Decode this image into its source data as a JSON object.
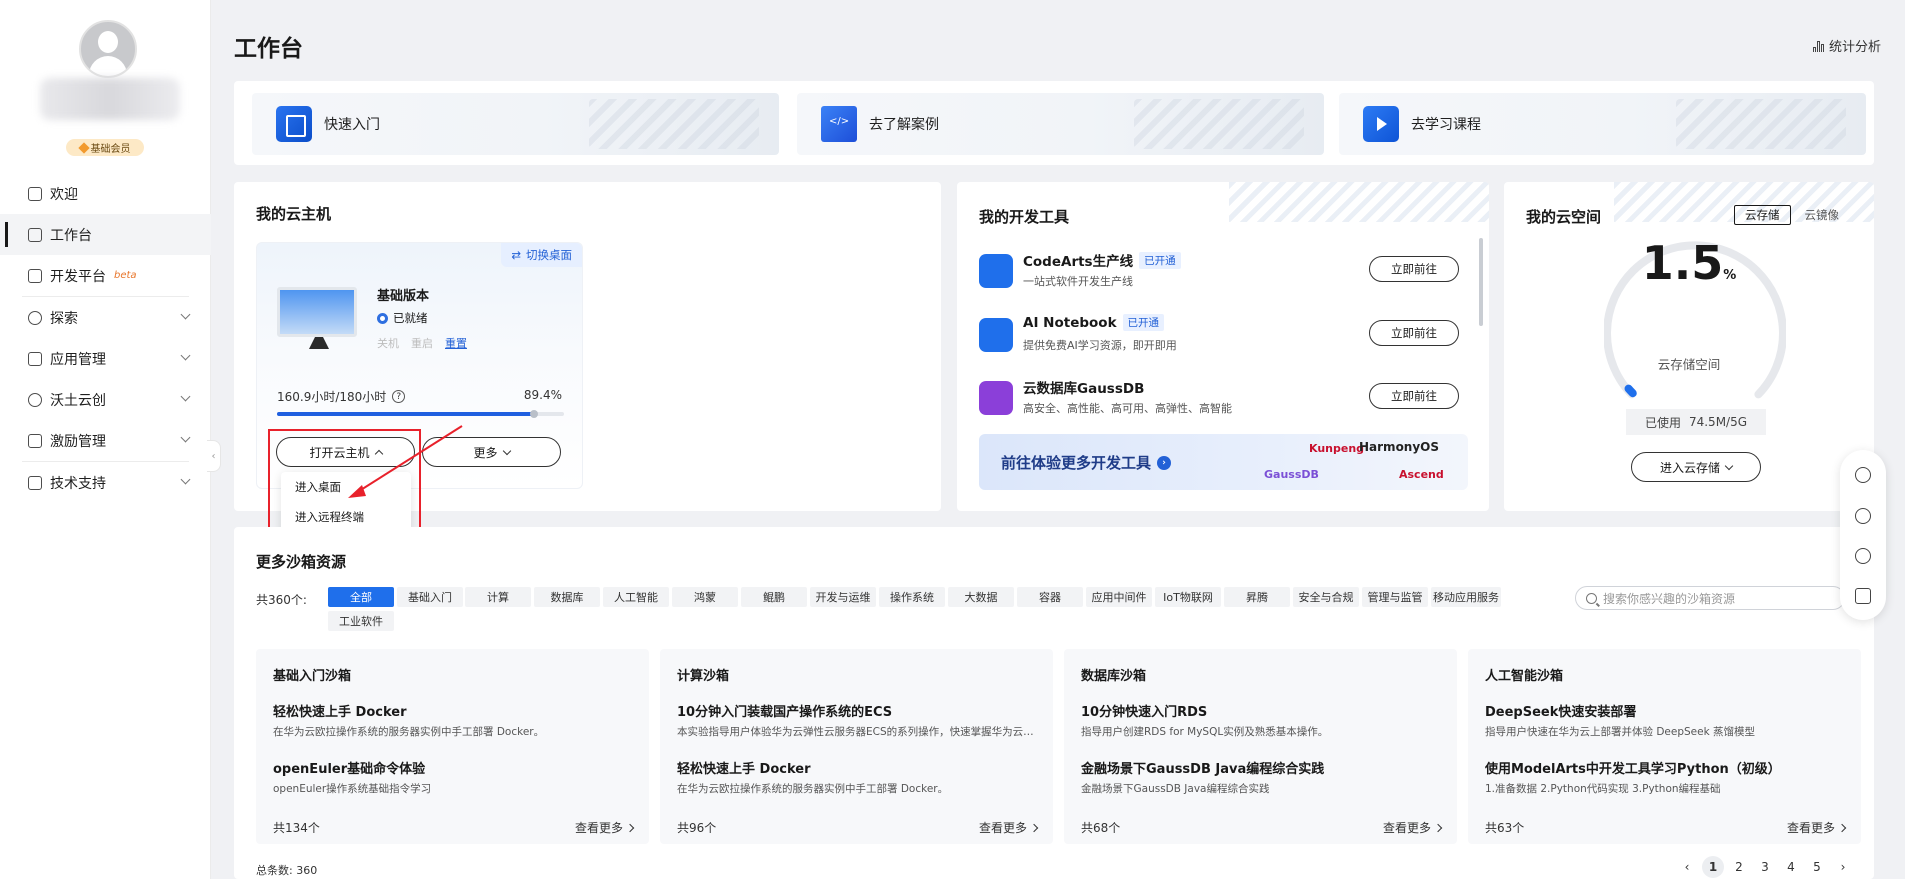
{
  "sidebar": {
    "member_badge": "基础会员",
    "nav": [
      {
        "label": "欢迎",
        "icon": "home-icon"
      },
      {
        "label": "工作台",
        "icon": "workbench-icon",
        "active": true
      },
      {
        "label": "开发平台",
        "icon": "dev-platform-icon",
        "badge": "beta"
      },
      {
        "label": "探索",
        "icon": "explore-icon",
        "expandable": true
      },
      {
        "label": "应用管理",
        "icon": "app-manage-icon",
        "expandable": true
      },
      {
        "label": "沃土云创",
        "icon": "cloud-create-icon",
        "expandable": true
      },
      {
        "label": "激励管理",
        "icon": "gift-icon",
        "expandable": true
      },
      {
        "label": "技术支持",
        "icon": "support-icon",
        "expandable": true
      }
    ]
  },
  "header": {
    "title": "工作台",
    "stats_link": "统计分析"
  },
  "quick": {
    "items": [
      {
        "label": "快速入门",
        "icon": "book-icon"
      },
      {
        "label": "去了解案例",
        "icon": "code-case-icon"
      },
      {
        "label": "去学习课程",
        "icon": "play-icon"
      }
    ]
  },
  "host": {
    "title": "我的云主机",
    "switch_desktop": "切换桌面",
    "version": "基础版本",
    "status": "已就绪",
    "actions": {
      "shutdown": "关机",
      "restart": "重启",
      "reset": "重置"
    },
    "usage_text": "160.9小时/180小时",
    "usage_pct": "89.4%",
    "usage_fraction": 0.894,
    "open_btn": "打开云主机",
    "more_btn": "更多",
    "menu": [
      "进入桌面",
      "进入远程终端"
    ]
  },
  "tools": {
    "title": "我的开发工具",
    "items": [
      {
        "name": "CodeArts生产线",
        "tag": "已开通",
        "desc": "一站式软件开发生产线",
        "btn": "立即前往",
        "color": "#1f6feb"
      },
      {
        "name": "AI Notebook",
        "tag": "已开通",
        "desc": "提供免费AI学习资源，即开即用",
        "btn": "立即前往",
        "color": "#1f6feb"
      },
      {
        "name": "云数据库GaussDB",
        "tag": "",
        "desc": "高安全、高性能、高可用、高弹性、高智能",
        "btn": "立即前往",
        "color": "#8b3fd9"
      }
    ],
    "promo": "前往体验更多开发工具",
    "logos": [
      "Kunpeng",
      "HarmonyOS",
      "GaussDB",
      "Ascend"
    ]
  },
  "space": {
    "title": "我的云空间",
    "tabs": [
      "云存储",
      "云镜像"
    ],
    "value": "1.5",
    "unit": "%",
    "label": "云存储空间",
    "used_label": "已使用",
    "used_value": "74.5M/5G",
    "usage_fraction": 0.015,
    "enter_btn": "进入云存储"
  },
  "sandbox": {
    "title": "更多沙箱资源",
    "total": "共360个:",
    "search_placeholder": "搜索你感兴趣的沙箱资源",
    "chips": [
      "全部",
      "基础入门",
      "计算",
      "数据库",
      "人工智能",
      "鸿蒙",
      "鲲鹏",
      "开发与运维",
      "操作系统",
      "大数据",
      "容器",
      "应用中间件",
      "IoT物联网",
      "昇腾",
      "安全与合规",
      "管理与监管",
      "移动应用服务",
      "工业软件"
    ],
    "columns": [
      {
        "title": "基础入门沙箱",
        "items": [
          {
            "t": "轻松快速上手 Docker",
            "d": "在华为云欧拉操作系统的服务器实例中手工部署 Docker。"
          },
          {
            "t": "openEuler基础命令体验",
            "d": "openEuler操作系统基础指令学习"
          }
        ],
        "count": "共134个",
        "more": "查看更多"
      },
      {
        "title": "计算沙箱",
        "items": [
          {
            "t": "10分钟入门装载国产操作系统的ECS",
            "d": "本实验指导用户体验华为云弹性云服务器ECS的系列操作，快速掌握华为云ECS的使用方法"
          },
          {
            "t": "轻松快速上手 Docker",
            "d": "在华为云欧拉操作系统的服务器实例中手工部署 Docker。"
          }
        ],
        "count": "共96个",
        "more": "查看更多"
      },
      {
        "title": "数据库沙箱",
        "items": [
          {
            "t": "10分钟快速入门RDS",
            "d": "指导用户创建RDS for MySQL实例及熟悉基本操作。"
          },
          {
            "t": "金融场景下GaussDB Java编程综合实践",
            "d": "金融场景下GaussDB Java编程综合实践"
          }
        ],
        "count": "共68个",
        "more": "查看更多"
      },
      {
        "title": "人工智能沙箱",
        "items": [
          {
            "t": "DeepSeek快速安装部署",
            "d": "指导用户快速在华为云上部署并体验 DeepSeek 蒸馏模型"
          },
          {
            "t": "使用ModelArts中开发工具学习Python（初级）",
            "d": "1.准备数据 2.Python代码实现 3.Python编程基础"
          }
        ],
        "count": "共63个",
        "more": "查看更多"
      }
    ],
    "footer_total": "总条数:  360",
    "pages": [
      "1",
      "2",
      "3",
      "4",
      "5"
    ]
  }
}
